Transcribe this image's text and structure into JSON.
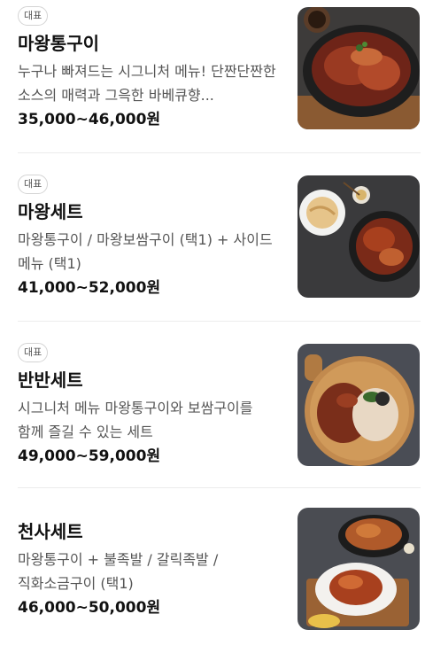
{
  "menu": {
    "items": [
      {
        "badge": "대표",
        "title": "마왕통구이",
        "description": "누구나 빠져드는 시그니처 메뉴! 단짠단짠한 소스의 매력과 그윽한 바베큐향...",
        "price": "35,000~46,000원",
        "image": "grilled-pork-pan-image"
      },
      {
        "badge": "대표",
        "title": "마왕세트",
        "description": "마왕통구이 / 마왕보쌈구이 (택1) + 사이드 메뉴 (택1)",
        "price": "41,000~52,000원",
        "image": "set-meal-image"
      },
      {
        "badge": "대표",
        "title": "반반세트",
        "description": "시그니처 메뉴 마왕통구이와 보쌈구이를 함께 즐길 수 있는 세트",
        "price": "49,000~59,000원",
        "image": "half-half-platter-image"
      },
      {
        "badge": "",
        "title": "천사세트",
        "description": "마왕통구이 + 불족발 / 갈릭족발 / 직화소금구이 (택1)",
        "price": "46,000~50,000원",
        "image": "angel-set-image"
      }
    ]
  },
  "colors": {
    "background": "#ffffff",
    "text_primary": "#111111",
    "text_secondary": "#555555",
    "badge_border": "#d4d4d4",
    "divider": "#ececec"
  }
}
